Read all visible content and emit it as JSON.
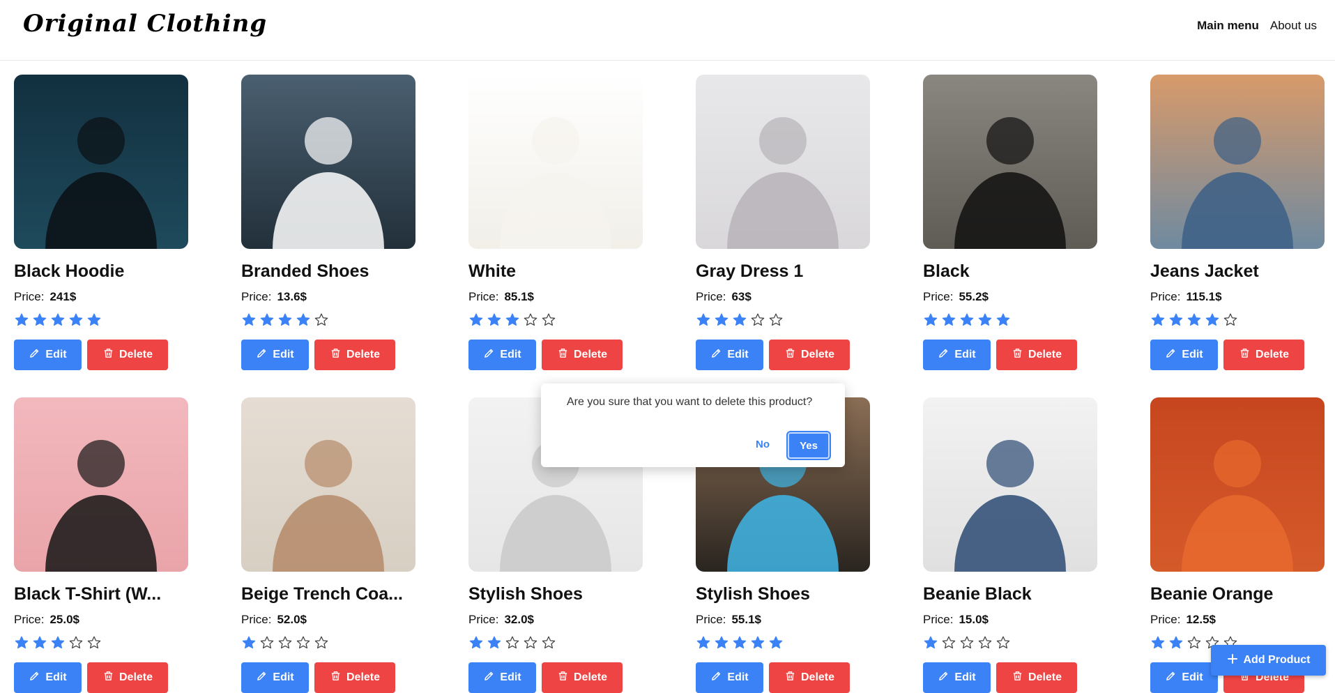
{
  "header": {
    "logo": "Original Clothing",
    "nav": [
      {
        "label": "Main menu",
        "active": true
      },
      {
        "label": "About us",
        "active": false
      }
    ]
  },
  "labels": {
    "price": "Price:",
    "edit": "Edit",
    "delete": "Delete"
  },
  "products": [
    {
      "name": "Black Hoodie",
      "price": "241$",
      "rating": 5,
      "img": "black-hoodie-photo"
    },
    {
      "name": "Branded Shoes",
      "price": "13.6$",
      "rating": 4,
      "img": "branded-shoes-photo"
    },
    {
      "name": "White",
      "price": "85.1$",
      "rating": 3,
      "img": "white-sweater-photo"
    },
    {
      "name": "Gray Dress 1",
      "price": "63$",
      "rating": 3,
      "img": "gray-dress-photo"
    },
    {
      "name": "Black",
      "price": "55.2$",
      "rating": 5,
      "img": "black-tshirt-photo"
    },
    {
      "name": "Jeans Jacket",
      "price": "115.1$",
      "rating": 4,
      "img": "jeans-jacket-photo"
    },
    {
      "name": "Black T-Shirt (W...",
      "price": "25.0$",
      "rating": 3,
      "img": "black-tshirt-women-photo"
    },
    {
      "name": "Beige Trench Coa...",
      "price": "52.0$",
      "rating": 1,
      "img": "beige-trench-coat-photo"
    },
    {
      "name": "Stylish Shoes",
      "price": "32.0$",
      "rating": 2,
      "img": "stylish-shoes-photo"
    },
    {
      "name": "Stylish Shoes",
      "price": "55.1$",
      "rating": 5,
      "img": "blue-sneaker-photo"
    },
    {
      "name": "Beanie Black",
      "price": "15.0$",
      "rating": 1,
      "img": "beanie-black-photo"
    },
    {
      "name": "Beanie Orange",
      "price": "12.5$",
      "rating": 2,
      "img": "beanie-orange-photo"
    }
  ],
  "dialog": {
    "message": "Are you sure that you want to delete this product?",
    "no": "No",
    "yes": "Yes"
  },
  "add_button": {
    "label": "Add Product"
  },
  "colors": {
    "primary": "#3b82f6",
    "danger": "#ef4444",
    "star": "#3b82f6"
  }
}
